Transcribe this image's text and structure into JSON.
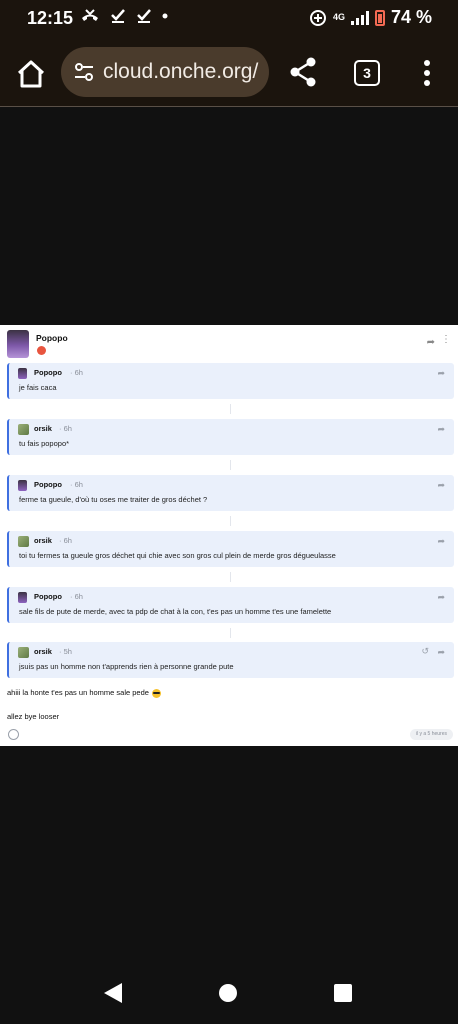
{
  "status_bar": {
    "time": "12:15",
    "left_icons": [
      "missed-call-icon",
      "check-icon",
      "check-icon",
      "dot-icon"
    ],
    "network": "4G",
    "battery": "74 %"
  },
  "browser": {
    "url": "cloud.onche.org/",
    "tab_count": "3"
  },
  "post": {
    "author": "Popopo",
    "replies": [
      {
        "name": "Popopo",
        "time": "· 6h",
        "text": "je fais caca",
        "avatar": "popopo"
      },
      {
        "name": "orsik",
        "time": "· 6h",
        "text": "tu fais popopo*",
        "avatar": "orsik"
      },
      {
        "name": "Popopo",
        "time": "· 6h",
        "text": "ferme ta gueule, d'où tu oses me traiter de gros déchet ?",
        "avatar": "popopo"
      },
      {
        "name": "orsik",
        "time": "· 6h",
        "text": "toi tu fermes ta gueule gros déchet qui chie avec son gros cul plein de merde gros dégueulasse",
        "avatar": "orsik"
      },
      {
        "name": "Popopo",
        "time": "· 6h",
        "text": "sale fils de pute de merde, avec ta pdp de chat à la con, t'es pas un homme t'es une famelette",
        "avatar": "popopo"
      },
      {
        "name": "orsik",
        "time": "· 5h",
        "text": "jsuis pas un homme non t'apprends rien à personne grande pute",
        "avatar": "orsik"
      }
    ],
    "body_lines": [
      "ahiii la honte t'es pas un homme sale pede",
      "allez bye looser"
    ],
    "timestamp": "il y a 5 heures"
  }
}
